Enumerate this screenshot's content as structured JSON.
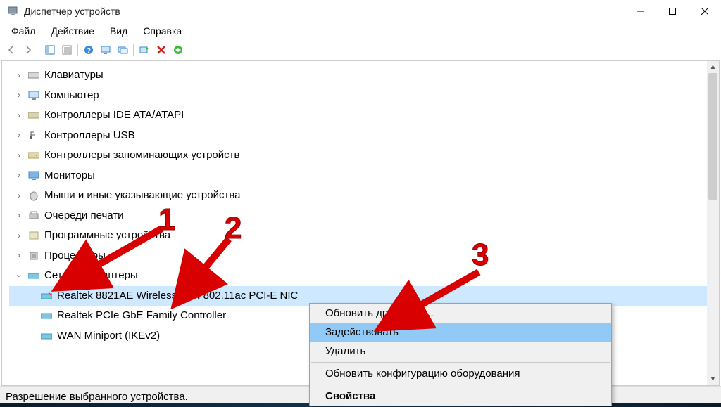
{
  "window": {
    "title": "Диспетчер устройств"
  },
  "menubar": {
    "file": "Файл",
    "action": "Действие",
    "view": "Вид",
    "help": "Справка"
  },
  "tree": {
    "items": [
      {
        "label": "Клавиатуры"
      },
      {
        "label": "Компьютер"
      },
      {
        "label": "Контроллеры IDE ATA/ATAPI"
      },
      {
        "label": "Контроллеры USB"
      },
      {
        "label": "Контроллеры запоминающих устройств"
      },
      {
        "label": "Мониторы"
      },
      {
        "label": "Мыши и иные указывающие устройства"
      },
      {
        "label": "Очереди печати"
      },
      {
        "label": "Программные устройства"
      },
      {
        "label": "Процессоры"
      }
    ],
    "network_category": "Сетевые адаптеры",
    "network_children": [
      {
        "label": "Realtek 8821AE Wireless LAN 802.11ac PCI-E NIC"
      },
      {
        "label": "Realtek PCIe GbE Family Controller"
      },
      {
        "label": "WAN Miniport (IKEv2)"
      }
    ]
  },
  "context_menu": {
    "update": "Обновить драйверы...",
    "enable": "Задействовать",
    "delete": "Удалить",
    "rescan": "Обновить конфигурацию оборудования",
    "properties": "Свойства"
  },
  "statusbar": {
    "text": "Разрешение выбранного устройства."
  },
  "annotations": {
    "n1": "1",
    "n2": "2",
    "n3": "3"
  }
}
